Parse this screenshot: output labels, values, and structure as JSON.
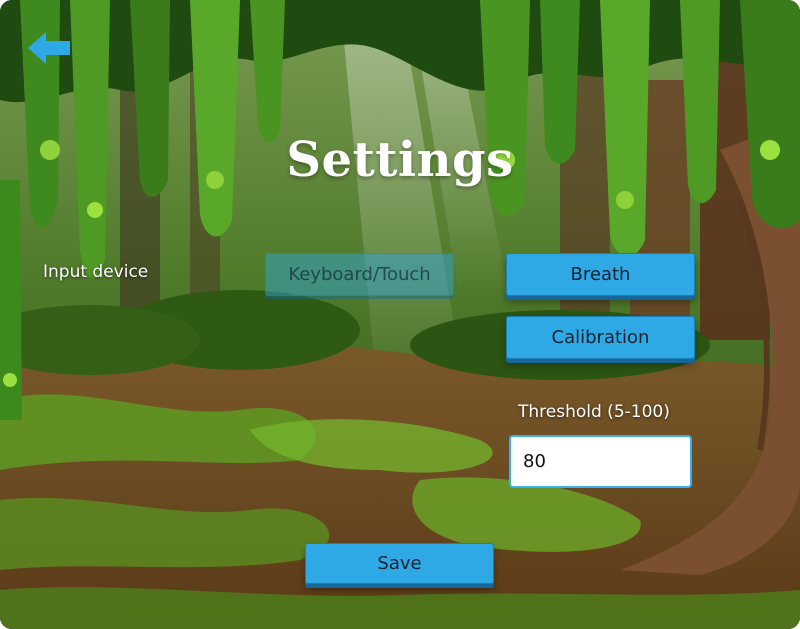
{
  "screen": {
    "title": "Settings"
  },
  "nav": {
    "back_icon": "arrow-left-icon",
    "back_color": "#2fa9e6"
  },
  "input_device": {
    "label": "Input device",
    "options": [
      {
        "label": "Keyboard/Touch",
        "selected": true
      },
      {
        "label": "Breath",
        "selected": false
      }
    ]
  },
  "calibration": {
    "label": "Calibration"
  },
  "threshold": {
    "label": "Threshold (5-100)",
    "value": "80"
  },
  "save": {
    "label": "Save"
  },
  "colors": {
    "button": "#2fa9e6",
    "button_shadow": "#17679a",
    "title": "#ffffff"
  }
}
